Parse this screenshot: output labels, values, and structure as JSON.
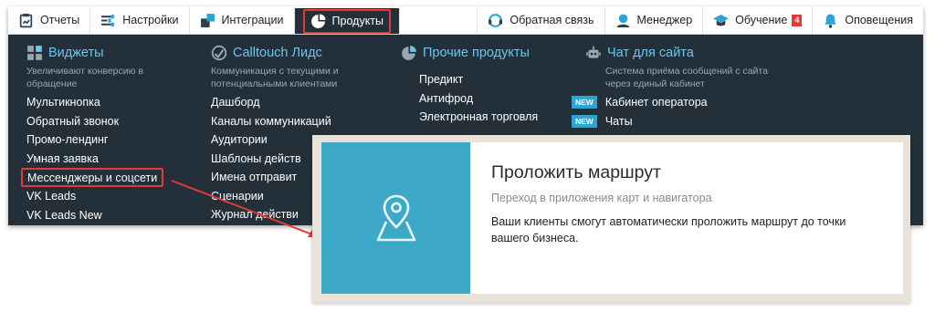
{
  "nav": {
    "left": [
      {
        "label": "Отчеты",
        "icon": "reports-icon"
      },
      {
        "label": "Настройки",
        "icon": "settings-icon"
      },
      {
        "label": "Интеграции",
        "icon": "integrations-icon"
      },
      {
        "label": "Продукты",
        "icon": "products-icon",
        "active": true
      }
    ],
    "right": [
      {
        "label": "Обратная связь",
        "icon": "feedback-icon"
      },
      {
        "label": "Менеджер",
        "icon": "manager-icon"
      },
      {
        "label": "Обучение",
        "icon": "education-icon",
        "badge": "4"
      },
      {
        "label": "Оповещения",
        "icon": "bell-icon"
      }
    ]
  },
  "menu": {
    "widgets": {
      "title": "Виджеты",
      "description": "Увеличивают конверсию в обращение",
      "items": [
        "Мультикнопка",
        "Обратный звонок",
        "Промо-лендинг",
        "Умная заявка",
        "Мессенджеры и соцсети",
        "VK Leads",
        "VK Leads New"
      ]
    },
    "leads": {
      "title": "Calltouch Лидс",
      "description": "Коммуникация с текущими и потенциальными клиентами",
      "items": [
        "Дашборд",
        "Каналы коммуникаций",
        "Аудитории",
        "Шаблоны действ",
        "Имена отправит",
        "Сценарии",
        "Журнал действи"
      ]
    },
    "other": {
      "title": "Прочие продукты",
      "items": [
        "Предикт",
        "Антифрод",
        "Электронная торговля"
      ]
    },
    "chat": {
      "title": "Чат для сайта",
      "description": "Система приёма сообщений с сайта через единый кабинет",
      "new_label": "NEW",
      "items": [
        "Кабинет оператора",
        "Чаты"
      ]
    }
  },
  "card": {
    "title": "Проложить маршрут",
    "subtitle": "Переход в приложения карт и навигатора",
    "text": "Ваши клиенты смогут автоматически проложить маршрут до точки вашего бизнеса.",
    "icon": "map-pin-icon"
  },
  "colors": {
    "menu_bg": "#233039",
    "accent": "#6cc5ef",
    "highlight": "#e53935",
    "card_image": "#3ea8c9"
  }
}
